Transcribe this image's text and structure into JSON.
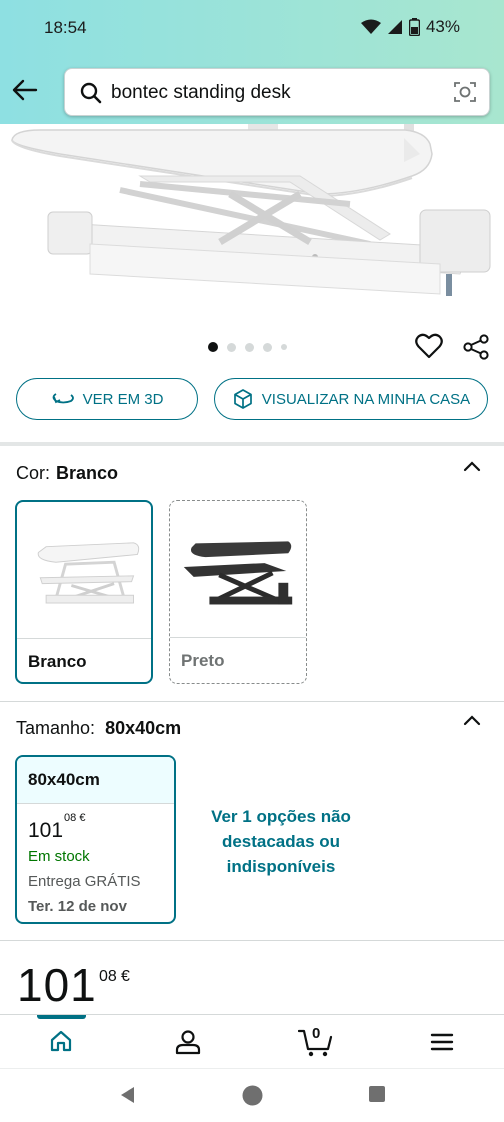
{
  "status_bar": {
    "time": "18:54",
    "battery": "43%"
  },
  "search": {
    "query": "bontec standing desk"
  },
  "gallery": {
    "dots": 5,
    "active_index": 0
  },
  "actions": {
    "view_3d": "VER EM 3D",
    "view_in_home": "VISUALIZAR NA MINHA CASA"
  },
  "color": {
    "label": "Cor:",
    "value": "Branco",
    "options": [
      {
        "name": "Branco",
        "selected": true
      },
      {
        "name": "Preto",
        "selected": false
      }
    ]
  },
  "size": {
    "label": "Tamanho:",
    "value": "80x40cm",
    "card": {
      "title": "80x40cm",
      "price_whole": "101",
      "price_cents": "08 €",
      "stock": "Em stock",
      "delivery": "Entrega GRÁTIS",
      "date": "Ter. 12 de nov"
    },
    "more_options": "Ver 1 opções não destacadas ou indisponíveis"
  },
  "price": {
    "whole": "101",
    "cents": "08",
    "currency": "€"
  },
  "nav": {
    "cart_count": "0",
    "active": "home"
  },
  "colors": {
    "accent": "#007185",
    "stock_green": "#007600",
    "header_from": "#8ee0e2",
    "header_to": "#a8e6cf"
  }
}
